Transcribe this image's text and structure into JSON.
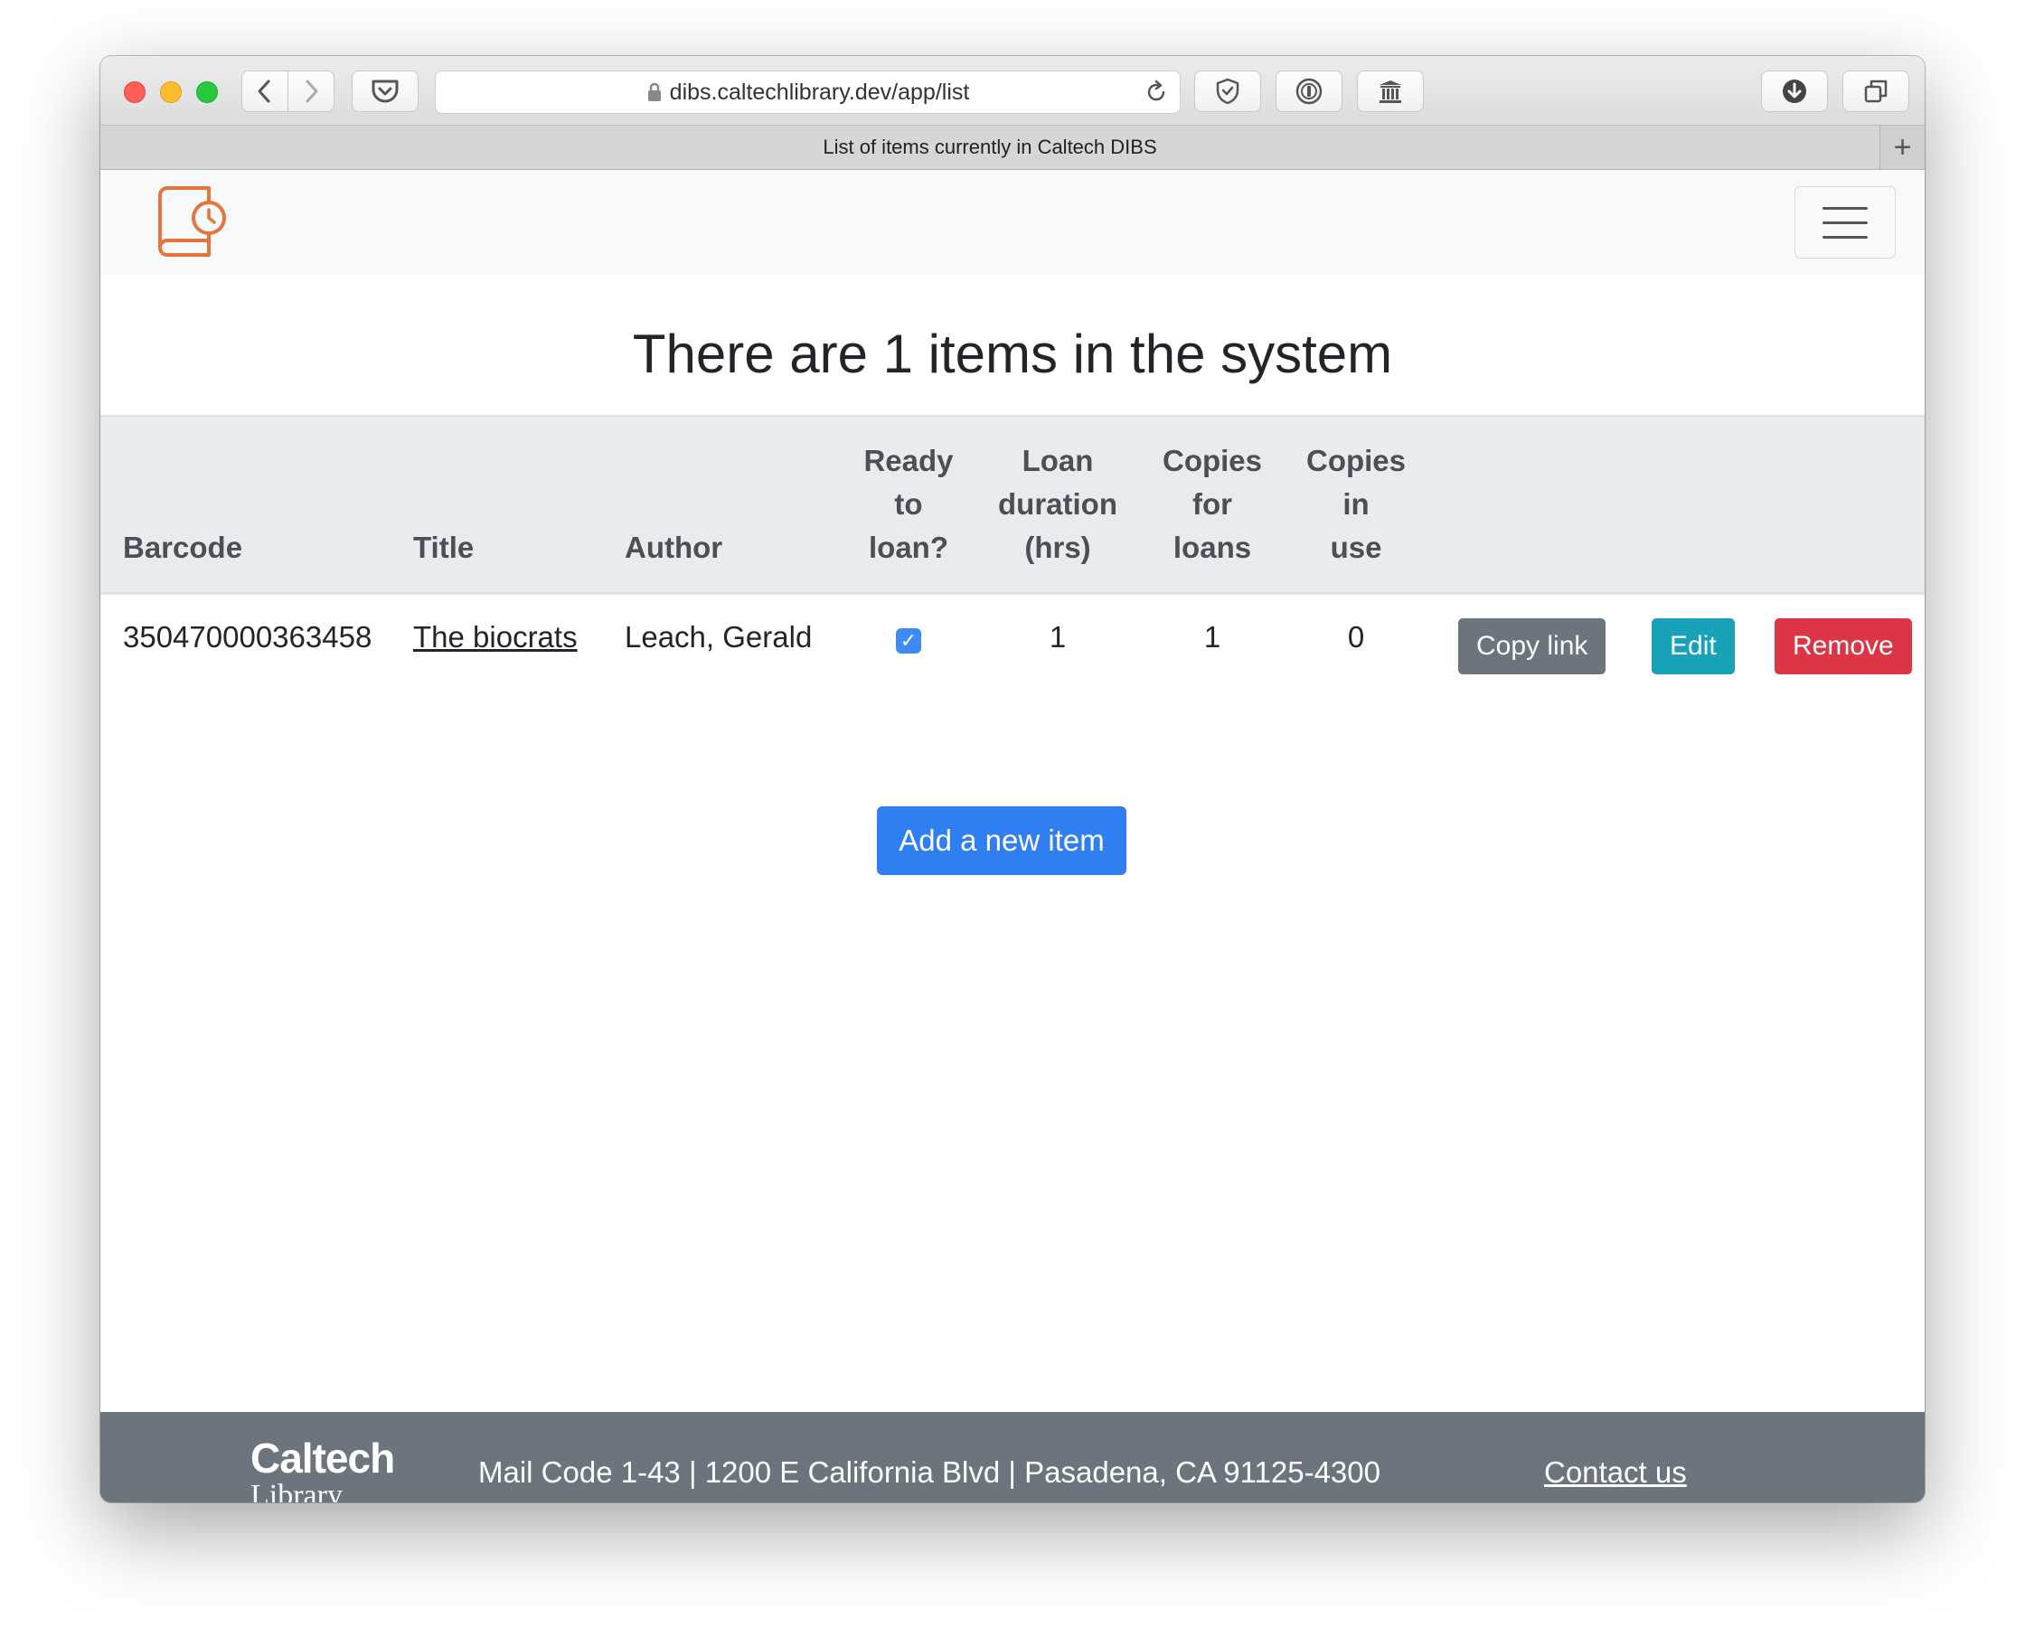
{
  "browser": {
    "url": "dibs.caltechlibrary.dev/app/list",
    "tab_title": "List of items currently in Caltech DIBS",
    "new_tab_symbol": "+"
  },
  "page": {
    "heading": "There are 1 items in the system",
    "table": {
      "headers": {
        "barcode": "Barcode",
        "title": "Title",
        "author": "Author",
        "ready_l1": "Ready",
        "ready_l2": "to",
        "ready_l3": "loan?",
        "loan_l1": "Loan",
        "loan_l2": "duration",
        "loan_l3": "(hrs)",
        "copies_l1": "Copies",
        "copies_l2": "for",
        "copies_l3": "loans",
        "inuse_l1": "Copies",
        "inuse_l2": "in",
        "inuse_l3": "use"
      },
      "rows": [
        {
          "barcode": "350470000363458",
          "title": "The biocrats",
          "author": "Leach, Gerald",
          "ready": true,
          "loan_duration": "1",
          "copies_for_loans": "1",
          "copies_in_use": "0"
        }
      ],
      "actions": {
        "copy_link": "Copy link",
        "edit": "Edit",
        "remove": "Remove"
      }
    },
    "add_button": "Add a new item"
  },
  "footer": {
    "logo_line1": "Caltech",
    "logo_line2": "Library",
    "address": "Mail Code 1-43 | 1200 E California Blvd | Pasadena, CA 91125-4300",
    "contact": "Contact us"
  },
  "colors": {
    "logo_orange": "#e8743b",
    "primary": "#2f7ff2",
    "secondary": "#6c757d",
    "info": "#17a2b8",
    "danger": "#dc3545"
  },
  "icons": {
    "back": "chevron-left-icon",
    "forward": "chevron-right-icon",
    "pocket": "pocket-icon",
    "lock": "lock-icon",
    "reload": "reload-icon",
    "shield": "shield-icon",
    "password": "password-manager-icon",
    "archive": "archive-icon",
    "download": "download-icon",
    "tabs": "tabs-overview-icon",
    "menu": "hamburger-menu-icon"
  }
}
